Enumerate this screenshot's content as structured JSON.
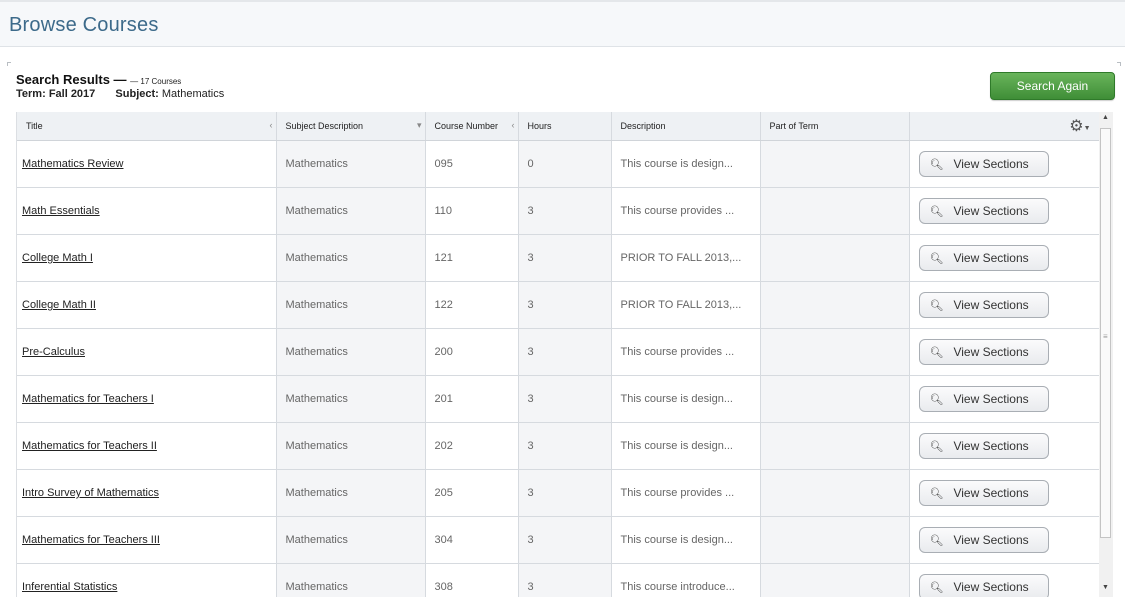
{
  "page": {
    "title": "Browse Courses"
  },
  "summary": {
    "results_label": "Search Results —",
    "count_label": "— 17 Courses",
    "term_label": "Term:",
    "term_value": "Fall 2017",
    "subject_label": "Subject:",
    "subject_value": "Mathematics"
  },
  "actions": {
    "search_again": "Search Again",
    "view_sections": "View Sections"
  },
  "columns": [
    "Title",
    "Subject Description",
    "Course Number",
    "Hours",
    "Description",
    "Part of Term",
    ""
  ],
  "rows": [
    {
      "title": "Mathematics Review",
      "subject": "Mathematics",
      "number": "095",
      "hours": "0",
      "description": "This course is design...",
      "part_of_term": ""
    },
    {
      "title": "Math Essentials",
      "subject": "Mathematics",
      "number": "110",
      "hours": "3",
      "description": "This course provides ...",
      "part_of_term": ""
    },
    {
      "title": "College Math I",
      "subject": "Mathematics",
      "number": "121",
      "hours": "3",
      "description": "PRIOR TO FALL 2013,...",
      "part_of_term": ""
    },
    {
      "title": "College Math II",
      "subject": "Mathematics",
      "number": "122",
      "hours": "3",
      "description": "PRIOR TO FALL 2013,...",
      "part_of_term": ""
    },
    {
      "title": "Pre-Calculus",
      "subject": "Mathematics",
      "number": "200",
      "hours": "3",
      "description": "This course provides ...",
      "part_of_term": ""
    },
    {
      "title": "Mathematics for Teachers I",
      "subject": "Mathematics",
      "number": "201",
      "hours": "3",
      "description": "This course is design...",
      "part_of_term": ""
    },
    {
      "title": "Mathematics for Teachers II",
      "subject": "Mathematics",
      "number": "202",
      "hours": "3",
      "description": "This course is design...",
      "part_of_term": ""
    },
    {
      "title": "Intro Survey of Mathematics",
      "subject": "Mathematics",
      "number": "205",
      "hours": "3",
      "description": "This course provides ...",
      "part_of_term": ""
    },
    {
      "title": "Mathematics for Teachers III",
      "subject": "Mathematics",
      "number": "304",
      "hours": "3",
      "description": "This course is design...",
      "part_of_term": ""
    },
    {
      "title": "Inferential Statistics",
      "subject": "Mathematics",
      "number": "308",
      "hours": "3",
      "description": "This course introduce...",
      "part_of_term": ""
    }
  ],
  "icons": {
    "gear": "gear-icon",
    "search": "magnifier-icon"
  },
  "colors": {
    "title_blue": "#3c6a8a",
    "search_again_green": "#4f9e45"
  }
}
